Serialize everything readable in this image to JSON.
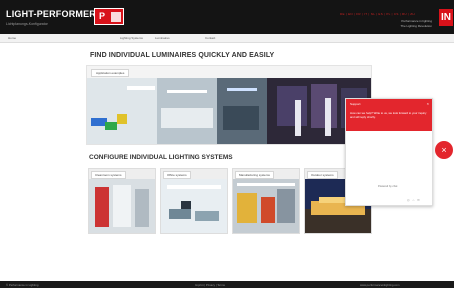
{
  "header": {
    "brand": "LIGHT-PERFORMER",
    "brand_sub": "Lichtplanungs-Konfigurator",
    "award_label": "P",
    "languages": "DE | EN | FR | IT | NL | ES | PL | CS | RU | ZH",
    "line1": "Performance in lighting",
    "line2": "The Lighting Revolution",
    "logo_letter": "IN"
  },
  "subnav": {
    "items": [
      "Home",
      "Lighting Systems",
      "Luminaires",
      "Contact"
    ]
  },
  "main": {
    "find_title": "FIND INDIVIDUAL LUMINAIRES QUICKLY AND EASILY",
    "find_chip": "Application examples",
    "configure_title": "CONFIGURE INDIVIDUAL LIGHTING SYSTEMS",
    "cards": [
      {
        "label": "Cleanroom systems"
      },
      {
        "label": "Office systems"
      },
      {
        "label": "Manufacturing systems"
      },
      {
        "label": "Outdoor systems"
      }
    ]
  },
  "chat": {
    "title": "Support",
    "message": "How can we help? Write to us, we look forward to your inquiry and will reply shortly.",
    "close": "×",
    "powered": "Powered by chat",
    "icons": "◎ ⌂ ✉"
  },
  "fab": {
    "symbol": "×"
  },
  "footer": {
    "left": "© Performance in Lighting",
    "middle": "Imprint | Privacy | Terms",
    "right": "www.performanceinlighting.com"
  },
  "colors": {
    "accent": "#e3262d",
    "header_bg": "#141414"
  }
}
